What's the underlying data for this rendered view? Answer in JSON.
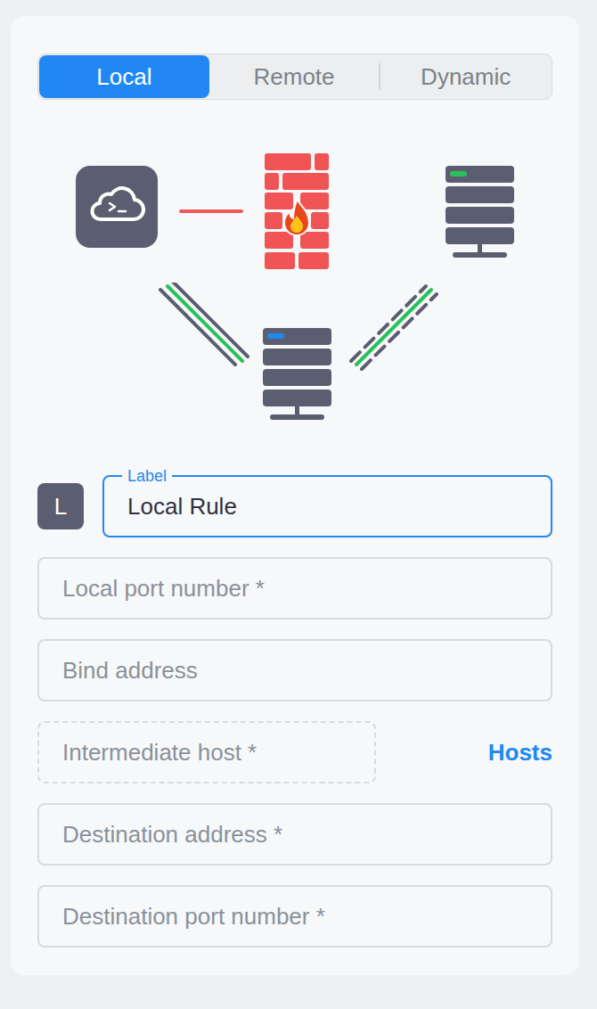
{
  "tabs": [
    {
      "label": "Local",
      "selected": true
    },
    {
      "label": "Remote",
      "selected": false
    },
    {
      "label": "Dynamic",
      "selected": false
    }
  ],
  "rule": {
    "badge": "L",
    "label_field": {
      "label": "Label",
      "value": "Local Rule",
      "focused": true
    }
  },
  "fields": [
    {
      "placeholder": "Local port number *",
      "kind": "input"
    },
    {
      "placeholder": "Bind address",
      "kind": "input"
    },
    {
      "placeholder": "Intermediate host *",
      "kind": "host-picker",
      "action": "Hosts"
    },
    {
      "placeholder": "Destination address *",
      "kind": "input"
    },
    {
      "placeholder": "Destination port number *",
      "kind": "input"
    }
  ]
}
